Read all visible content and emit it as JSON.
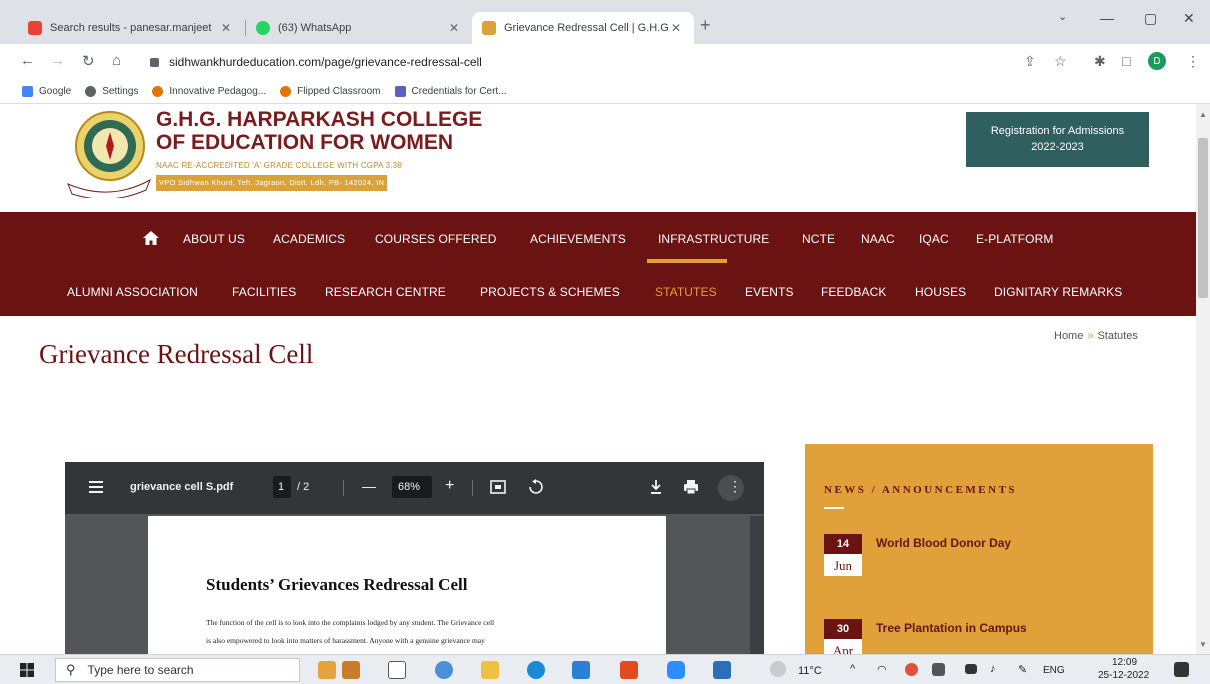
{
  "browser": {
    "tabs": [
      {
        "title": "Search results - panesar.manjeet",
        "favicon_color": "#ea4335"
      },
      {
        "title": "(63) WhatsApp",
        "favicon_color": "#25d366"
      },
      {
        "title": "Grievance Redressal Cell | G.H.G.",
        "favicon_color": "#d9a23a"
      }
    ],
    "url": "sidhwankhurdeducation.com/page/grievance-redressal-cell",
    "profile_initial": "D",
    "bookmarks": [
      {
        "label": "Google",
        "color": "#4285f4"
      },
      {
        "label": "Settings",
        "color": "#5f6368"
      },
      {
        "label": "Innovative Pedagog...",
        "color": "#e8710a"
      },
      {
        "label": "Flipped Classroom",
        "color": "#e8710a"
      },
      {
        "label": "Credentials for Cert...",
        "color": "#5b5fc7"
      }
    ]
  },
  "site": {
    "college_line1": "G.H.G. HARPARKASH COLLEGE",
    "college_line2": "OF EDUCATION FOR WOMEN",
    "naac": "NAAC RE-ACCREDITED 'A' GRADE COLLEGE WITH CGPA 3.38",
    "address": "VPO Sidhwan Khurd, Teh. Jagraon, Distt. Ldh. PB- 142024, IN",
    "registration_line1": "Registration for Admissions",
    "registration_line2": "2022-2023",
    "menu_row1": [
      "ABOUT US",
      "ACADEMICS",
      "COURSES OFFERED",
      "ACHIEVEMENTS",
      "INFRASTRUCTURE",
      "NCTE",
      "NAAC",
      "IQAC",
      "E-PLATFORM"
    ],
    "menu_row2": [
      "ALUMNI ASSOCIATION",
      "FACILITIES",
      "RESEARCH CENTRE",
      "PROJECTS & SCHEMES",
      "STATUTES",
      "EVENTS",
      "FEEDBACK",
      "HOUSES",
      "DIGNITARY REMARKS"
    ],
    "active_menu": "STATUTES",
    "page_title": "Grievance Redressal Cell",
    "breadcrumb": {
      "home": "Home",
      "separator": "»",
      "current": "Statutes"
    },
    "accent_color": "#e0a03a",
    "brand_color": "#6b1212"
  },
  "pdf": {
    "filename": "grievance cell S.pdf",
    "page": "1",
    "pages": "/ 2",
    "zoom": "68%",
    "heading": "Students’ Grievances Redressal Cell",
    "text_line1": "The function of the cell is to look into the complaints lodged by any student. The Grievance cell",
    "text_line2": "is also empowered to look into matters of harassment. Anyone with a genuine grievance may"
  },
  "news": {
    "title": "NEWS / ANNOUNCEMENTS",
    "items": [
      {
        "day": "14",
        "month": "Jun",
        "text": "World Blood Donor Day"
      },
      {
        "day": "30",
        "month": "Apr",
        "text": "Tree Plantation in Campus"
      }
    ]
  },
  "taskbar": {
    "search_placeholder": "Type here to search",
    "temperature": "11°C",
    "language": "ENG",
    "time": "12:09",
    "date": "25-12-2022"
  }
}
